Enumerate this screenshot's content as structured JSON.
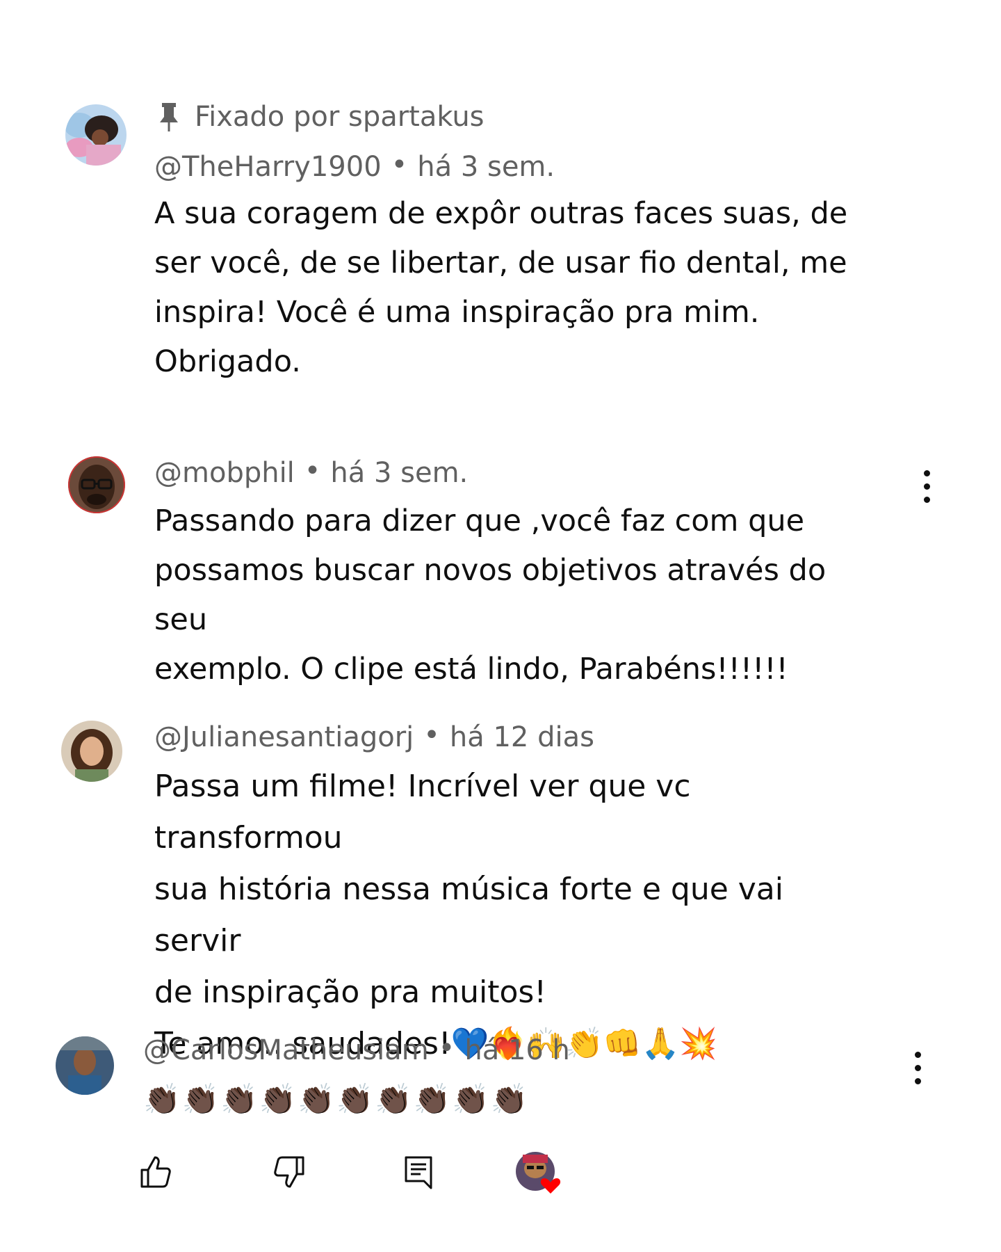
{
  "comments": [
    {
      "pinned_label": "Fixado por spartakus",
      "author": "@TheHarry1900",
      "time": "há 3 sem.",
      "text": "A sua coragem de expôr outras faces suas, de\nser você, de se libertar, de usar fio dental, me\ninspira! Você é uma inspiração pra mim.\nObrigado."
    },
    {
      "author": "@mobphil",
      "time": "há 3 sem.",
      "text": "Passando para dizer que ,você faz com que\npossamos buscar novos objetivos através do seu\nexemplo. O clipe está lindo, Parabéns!!!!!!"
    },
    {
      "author": "@Julianesantiagorj",
      "time": "há 12 dias",
      "text": "Passa um filme! Incrível ver que vc transformou\nsua história nessa música forte e que vai servir\nde inspiração pra muitos!\nTe amo.. saudades!💙❤️‍🔥🙌👏👊🙏💥"
    },
    {
      "author": "@CarlosMatheusiam",
      "time": "há 16 h",
      "text": "👏🏿👏🏿👏🏿👏🏿👏🏿👏🏿👏🏿👏🏿👏🏿👏🏿"
    }
  ],
  "separator": "•",
  "icons": {
    "pin": "pin-icon",
    "more": "more-vert-icon",
    "like": "thumbs-up-icon",
    "dislike": "thumbs-down-icon",
    "reply": "reply-icon",
    "creator_heart": "creator-heart-icon"
  },
  "colors": {
    "text_primary": "#0f0f0f",
    "text_secondary": "#606060",
    "heart": "#ff0000"
  }
}
